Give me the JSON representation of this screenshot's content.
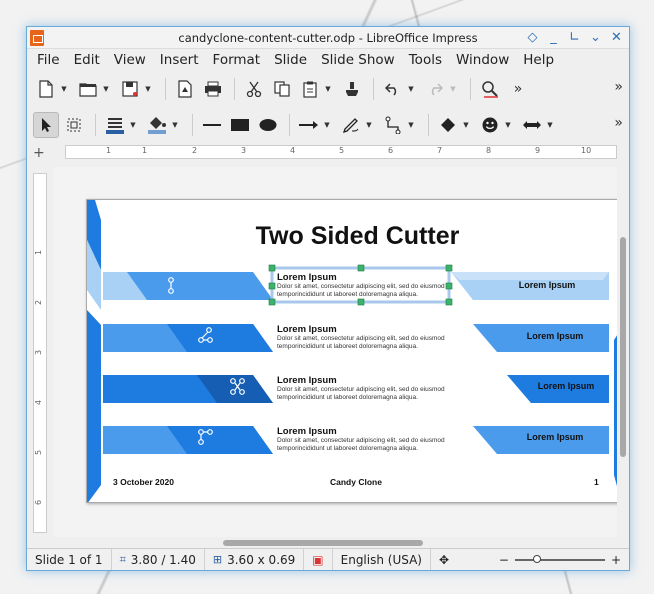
{
  "window": {
    "title": "candyclone-content-cutter.odp - LibreOffice Impress"
  },
  "menu": [
    "File",
    "Edit",
    "View",
    "Insert",
    "Format",
    "Slide",
    "Slide Show",
    "Tools",
    "Window",
    "Help"
  ],
  "ruler": {
    "h_labels": [
      "1",
      "1",
      "2",
      "3",
      "4",
      "5",
      "6",
      "7",
      "8",
      "9",
      "10",
      "11",
      "12"
    ],
    "v_labels": [
      "1",
      "2",
      "3",
      "4",
      "5",
      "6"
    ]
  },
  "slide": {
    "title": "Two Sided Cutter",
    "rows": [
      {
        "heading": "Lorem Ipsum",
        "line1": "Dolor sit amet, consectetur adipiscing elit, sed do eiusmod",
        "line2": "temporincididunt ut laboreet doloremagna aliqua.",
        "right_label": "Lorem Ipsum"
      },
      {
        "heading": "Lorem Ipsum",
        "line1": "Dolor sit amet, consectetur adipiscing elit, sed do eiusmod",
        "line2": "temporincididunt ut laboreet doloremagna aliqua.",
        "right_label": "Lorem Ipsum"
      },
      {
        "heading": "Lorem Ipsum",
        "line1": "Dolor sit amet, consectetur adipiscing elit, sed do eiusmod",
        "line2": "temporincididunt ut laboreet doloremagna aliqua.",
        "right_label": "Lorem Ipsum"
      },
      {
        "heading": "Lorem Ipsum",
        "line1": "Dolor sit amet, consectetur adipiscing elit, sed do eiusmod",
        "line2": "temporincididunt ut laboreet doloremagna aliqua.",
        "right_label": "Lorem Ipsum"
      }
    ],
    "footer": {
      "date": "3 October 2020",
      "author": "Candy Clone",
      "page_number": "1"
    }
  },
  "status": {
    "slide": "Slide 1 of 1",
    "position": "3.80 / 1.40",
    "size": "3.60 x 0.69",
    "language": "English (USA)"
  },
  "colors": {
    "accent_blue": "#1e7be0",
    "light_blue": "#a9d0f5",
    "mid_blue": "#4a9bec"
  }
}
